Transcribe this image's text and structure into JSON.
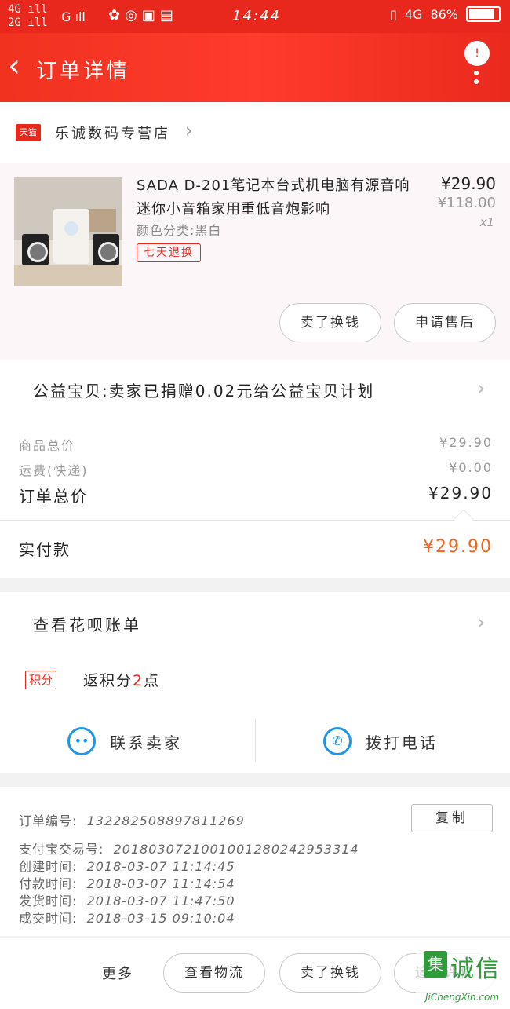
{
  "status_bar": {
    "signal_1": "4G",
    "signal_2": "2G",
    "signal_3": "G",
    "time": "14:44",
    "network": "4G",
    "battery": "86%"
  },
  "header": {
    "title": "订单详情",
    "badge": "!"
  },
  "store": {
    "platform_badge": "天猫",
    "name": "乐诚数码专营店"
  },
  "product": {
    "title": "SADA D-201笔记本台式机电脑有源音响迷你小音箱家用重低音炮影响",
    "variant": "颜色分类:黑白",
    "tag": "七天退换",
    "price": "¥29.90",
    "original_price": "¥118.00",
    "quantity": "x1",
    "buttons": [
      "卖了换钱",
      "申请售后"
    ]
  },
  "charity": {
    "text": "公益宝贝:卖家已捐赠0.02元给公益宝贝计划"
  },
  "totals": {
    "goods_total_label": "商品总价",
    "goods_total": "¥29.90",
    "shipping_label": "运费(快递)",
    "shipping": "¥0.00",
    "order_total_label": "订单总价",
    "order_total": "¥29.90",
    "paid_label": "实付款",
    "paid": "¥29.90"
  },
  "huabei": {
    "text": "查看花呗账单"
  },
  "points": {
    "tag": "积分",
    "prefix": "返积分",
    "count": "2",
    "suffix": "点"
  },
  "contact": {
    "seller": "联系卖家",
    "phone": "拨打电话"
  },
  "order_info": {
    "order_no_label": "订单编号:",
    "order_no": "132282508897811269",
    "copy_button": "复制",
    "alipay_label": "支付宝交易号:",
    "alipay_no": "2018030721001001280242953314",
    "created_label": "创建时间:",
    "created": "2018-03-07  11:14:45",
    "paid_label": "付款时间:",
    "paid": "2018-03-07  11:14:54",
    "shipped_label": "发货时间:",
    "shipped": "2018-03-07  11:47:50",
    "done_label": "成交时间:",
    "done": "2018-03-15  09:10:04"
  },
  "bottom_bar": {
    "more": "更多",
    "buttons": [
      "查看物流",
      "卖了换钱",
      "追加评价"
    ]
  },
  "watermark": {
    "logo": "集",
    "name": "诚信",
    "url": "JiChengXin.com"
  },
  "colors": {
    "brand_red": "#e8281d",
    "price_orange": "#f5631a",
    "link_blue": "#1d97e6"
  }
}
